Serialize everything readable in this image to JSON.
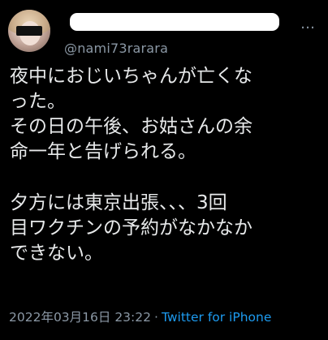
{
  "tweet": {
    "handle": "@nami73rarara",
    "more_icon": "…",
    "lines_p1": [
      "夜中におじいちゃんが亡くな",
      "った。",
      "その日の午後、お姑さんの余",
      "命一年と告げられる。"
    ],
    "lines_p2": [
      "夕方には東京出張、、、3回",
      "目ワクチンの予約がなかなか",
      "できない。"
    ],
    "timestamp": "2022年03月16日 23:22",
    "separator": "·",
    "source": "Twitter for iPhone"
  }
}
